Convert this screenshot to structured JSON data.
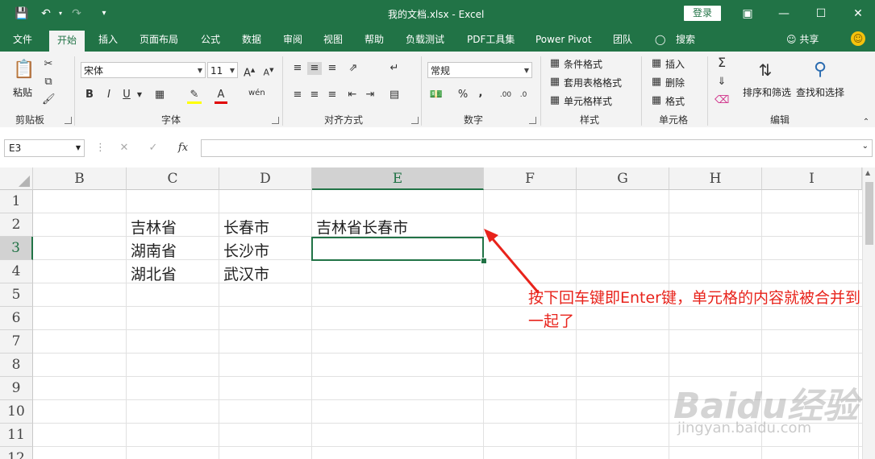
{
  "window": {
    "title": "我的文档.xlsx  -  Excel",
    "login": "登录"
  },
  "tabs": [
    "文件",
    "开始",
    "插入",
    "页面布局",
    "公式",
    "数据",
    "审阅",
    "视图",
    "帮助",
    "负载测试",
    "PDF工具集",
    "Power Pivot",
    "团队",
    "搜索"
  ],
  "tab_active": "开始",
  "share": "共享",
  "ribbon": {
    "clipboard": {
      "paste": "粘贴",
      "label": "剪贴板"
    },
    "font": {
      "name": "宋体",
      "size": "11",
      "bold": "B",
      "italic": "I",
      "underline": "U",
      "label": "字体"
    },
    "alignment": {
      "label": "对齐方式"
    },
    "number": {
      "format": "常规",
      "percent": "%",
      "comma": ",",
      "label": "数字"
    },
    "styles": {
      "conditional": "条件格式",
      "table": "套用表格格式",
      "cell_styles": "单元格样式",
      "label": "样式"
    },
    "cells": {
      "insert": "插入",
      "delete": "删除",
      "format": "格式",
      "label": "单元格"
    },
    "editing": {
      "sort": "排序和筛选",
      "find": "查找和选择",
      "label": "编辑"
    }
  },
  "formula_bar": {
    "name_box": "E3",
    "fx": "fx",
    "value": ""
  },
  "sheet": {
    "columns": [
      "B",
      "C",
      "D",
      "E",
      "F",
      "G",
      "H",
      "I"
    ],
    "selected_column": "E",
    "rows": [
      "1",
      "2",
      "3",
      "4",
      "5",
      "6",
      "7",
      "8",
      "9",
      "10",
      "11",
      "12"
    ],
    "selected_row": "3",
    "cells": {
      "C2": "吉林省",
      "D2": "长春市",
      "E2": "吉林省长春市",
      "C3": "湖南省",
      "D3": "长沙市",
      "C4": "湖北省",
      "D4": "武汉市"
    }
  },
  "annotation": "按下回车键即Enter键，单元格的内容就被合并到一起了",
  "watermark": {
    "logo": "Baidu经验",
    "url": "jingyan.baidu.com"
  },
  "colors": {
    "excel_green": "#217346",
    "annotation_red": "#e8231b"
  }
}
